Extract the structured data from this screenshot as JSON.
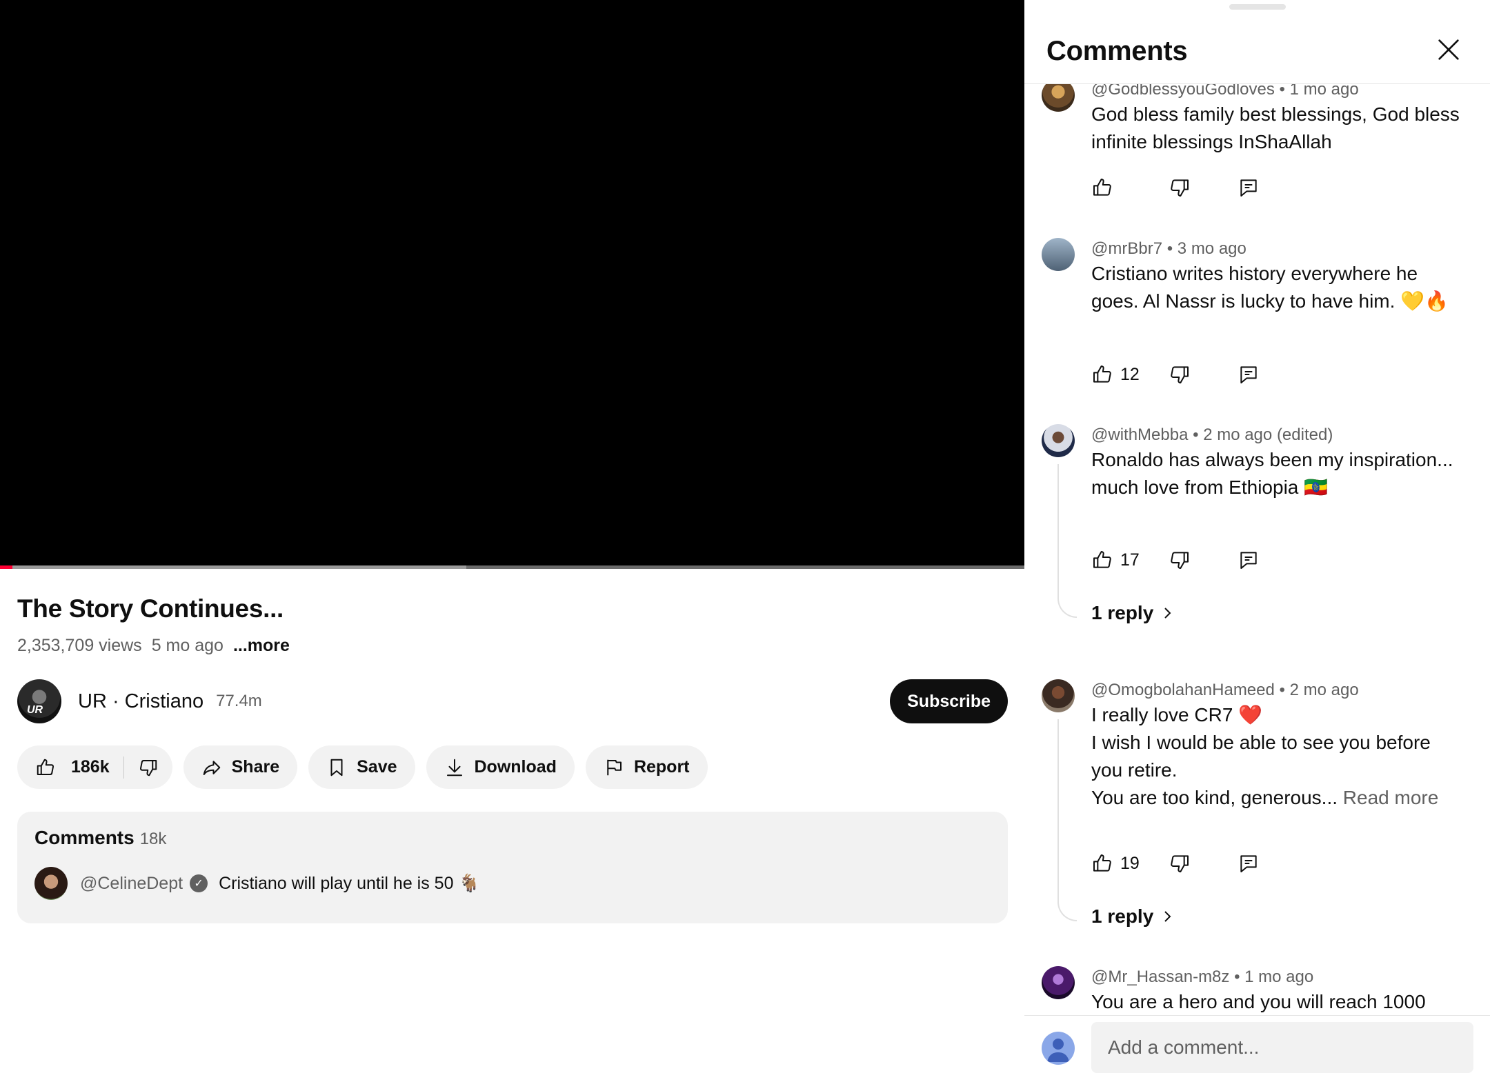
{
  "player": {
    "progress_fraction": 0.012,
    "buffered_fraction": 0.455,
    "colors": {
      "played": "#ff0033",
      "buffer": "#9a9a9a"
    }
  },
  "video": {
    "title": "The Story Continues...",
    "views": "2,353,709 views",
    "age": "5 mo ago",
    "more": "...more"
  },
  "channel": {
    "name": "UR · Cristiano",
    "subscribers": "77.4m",
    "subscribe_label": "Subscribe"
  },
  "actions": {
    "likes": "186k",
    "share": "Share",
    "save": "Save",
    "download": "Download",
    "report": "Report"
  },
  "comments_preview": {
    "title": "Comments",
    "count": "18k",
    "handle": "@CelineDept",
    "text": "Cristiano will play until he is 50 🐐"
  },
  "panel": {
    "title": "Comments",
    "composer_placeholder": "Add a comment...",
    "comments": [
      {
        "handle": "@GodblessyouGodloves",
        "age": "1 mo ago",
        "edited": "",
        "text": "God bless family best blessings, God bless infinite blessings InShaAllah",
        "likes": "",
        "replies": ""
      },
      {
        "handle": "@mrBbr7",
        "age": "3 mo ago",
        "edited": "",
        "text": "Cristiano writes history everywhere he goes. Al Nassr is lucky to have him. 💛🔥",
        "likes": "12",
        "replies": ""
      },
      {
        "handle": "@withMebba",
        "age": "2 mo ago",
        "edited": "(edited)",
        "text": "Ronaldo has always been my inspiration... much love from Ethiopia 🇪🇹",
        "likes": "17",
        "replies": "1 reply"
      },
      {
        "handle": "@OmogbolahanHameed",
        "age": "2 mo ago",
        "edited": "",
        "line1": "I really love CR7 ❤️",
        "line2": "I wish I would be able to see you before you retire.",
        "line3": "You are too kind, generous...",
        "read_more": "Read more",
        "likes": "19",
        "replies": "1 reply"
      },
      {
        "handle": "@Mr_Hassan-m8z",
        "age": "1 mo ago",
        "edited": "",
        "text": "You are a hero and you will reach 1000",
        "likes": "",
        "replies": ""
      }
    ]
  },
  "icons": {
    "like": "thumbs-up-icon",
    "dislike": "thumbs-down-icon",
    "share": "share-arrow-icon",
    "save": "bookmark-icon",
    "download": "download-icon",
    "report": "flag-icon",
    "reply": "reply-icon",
    "close": "close-icon",
    "chevron": "chevron-right-icon",
    "verified": "check-icon"
  }
}
